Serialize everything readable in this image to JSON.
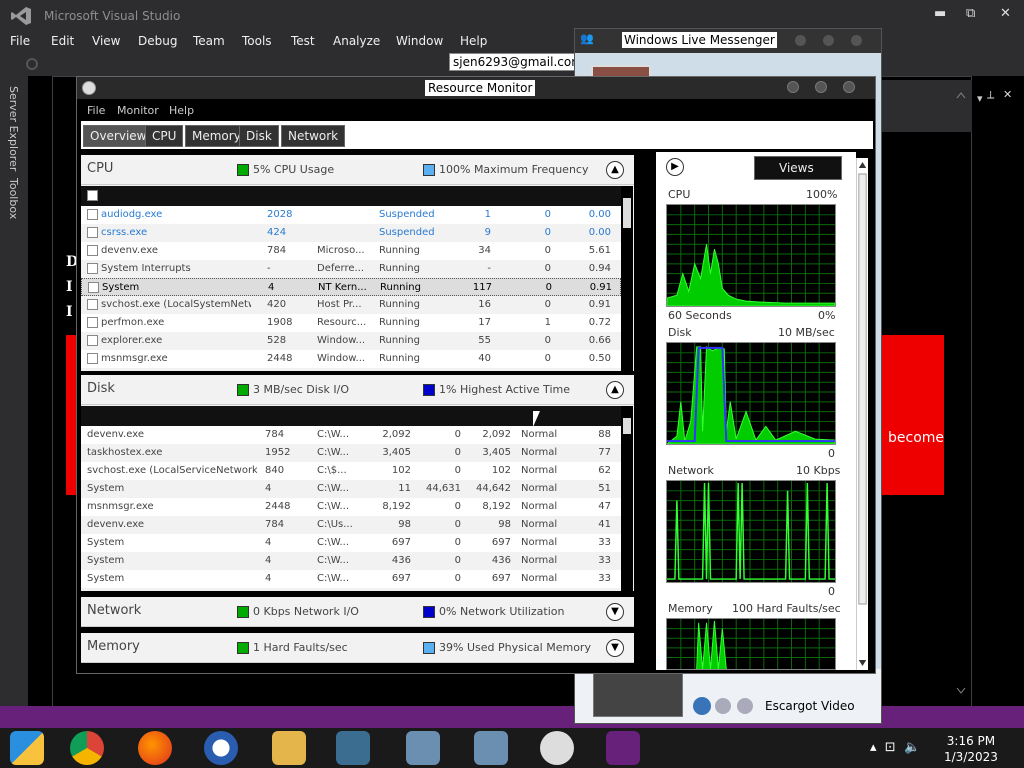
{
  "vs": {
    "title": "Microsoft Visual Studio",
    "window_controls": {
      "minimize": "✕",
      "maximize": "⧉",
      "close": "✕"
    },
    "menu": [
      "File",
      "Edit",
      "View",
      "Debug",
      "Team",
      "Tools",
      "Test",
      "Analyze",
      "Window",
      "Help"
    ],
    "account_email": "sjen6293@gmail.com",
    "side_tabs": [
      "Server Explorer",
      "Toolbox"
    ],
    "doc_letters": [
      "D",
      "I",
      "I"
    ],
    "red_box_text": "become",
    "accent": "#68217a"
  },
  "messenger": {
    "title": "Windows Live Messenger",
    "video_label": "Escargot Video"
  },
  "resmon": {
    "title": "Resource Monitor",
    "menu": [
      "File",
      "Monitor",
      "Help"
    ],
    "tabs": [
      "Overview",
      "CPU",
      "Memory",
      "Disk",
      "Network"
    ],
    "active_tab": "Overview",
    "cpu": {
      "title": "CPU",
      "stat1": "5% CPU Usage",
      "stat2": "100% Maximum Frequency",
      "rows": [
        {
          "name": "audiodg.exe",
          "pid": "2028",
          "desc": "",
          "status": "Suspended",
          "threads": "1",
          "cpu": "0",
          "avg": "0.00",
          "style": "blue"
        },
        {
          "name": "csrss.exe",
          "pid": "424",
          "desc": "",
          "status": "Suspended",
          "threads": "9",
          "cpu": "0",
          "avg": "0.00",
          "style": "blue"
        },
        {
          "name": "devenv.exe",
          "pid": "784",
          "desc": "Microso...",
          "status": "Running",
          "threads": "34",
          "cpu": "0",
          "avg": "5.61",
          "style": ""
        },
        {
          "name": "System Interrupts",
          "pid": "-",
          "desc": "Deferre...",
          "status": "Running",
          "threads": "-",
          "cpu": "0",
          "avg": "0.94",
          "style": ""
        },
        {
          "name": "System",
          "pid": "4",
          "desc": "NT Kern...",
          "status": "Running",
          "threads": "117",
          "cpu": "0",
          "avg": "0.91",
          "style": "sel"
        },
        {
          "name": "svchost.exe (LocalSystemNetw...",
          "pid": "420",
          "desc": "Host Pr...",
          "status": "Running",
          "threads": "16",
          "cpu": "0",
          "avg": "0.91",
          "style": ""
        },
        {
          "name": "perfmon.exe",
          "pid": "1908",
          "desc": "Resourc...",
          "status": "Running",
          "threads": "17",
          "cpu": "1",
          "avg": "0.72",
          "style": ""
        },
        {
          "name": "explorer.exe",
          "pid": "528",
          "desc": "Window...",
          "status": "Running",
          "threads": "55",
          "cpu": "0",
          "avg": "0.66",
          "style": ""
        },
        {
          "name": "msnmsgr.exe",
          "pid": "2448",
          "desc": "Window...",
          "status": "Running",
          "threads": "40",
          "cpu": "0",
          "avg": "0.50",
          "style": ""
        }
      ]
    },
    "disk": {
      "title": "Disk",
      "stat1": "3 MB/sec Disk I/O",
      "stat2": "1% Highest Active Time",
      "rows": [
        {
          "name": "devenv.exe",
          "pid": "784",
          "file": "C:\\W...",
          "read": "2,092",
          "write": "0",
          "total": "2,092",
          "prio": "Normal",
          "resp": "88"
        },
        {
          "name": "taskhostex.exe",
          "pid": "1952",
          "file": "C:\\W...",
          "read": "3,405",
          "write": "0",
          "total": "3,405",
          "prio": "Normal",
          "resp": "77"
        },
        {
          "name": "svchost.exe (LocalServiceNetwork...",
          "pid": "840",
          "file": "C:\\$...",
          "read": "102",
          "write": "0",
          "total": "102",
          "prio": "Normal",
          "resp": "62"
        },
        {
          "name": "System",
          "pid": "4",
          "file": "C:\\W...",
          "read": "11",
          "write": "44,631",
          "total": "44,642",
          "prio": "Normal",
          "resp": "51"
        },
        {
          "name": "msnmsgr.exe",
          "pid": "2448",
          "file": "C:\\W...",
          "read": "8,192",
          "write": "0",
          "total": "8,192",
          "prio": "Normal",
          "resp": "47"
        },
        {
          "name": "devenv.exe",
          "pid": "784",
          "file": "C:\\Us...",
          "read": "98",
          "write": "0",
          "total": "98",
          "prio": "Normal",
          "resp": "41"
        },
        {
          "name": "System",
          "pid": "4",
          "file": "C:\\W...",
          "read": "697",
          "write": "0",
          "total": "697",
          "prio": "Normal",
          "resp": "33"
        },
        {
          "name": "System",
          "pid": "4",
          "file": "C:\\W...",
          "read": "436",
          "write": "0",
          "total": "436",
          "prio": "Normal",
          "resp": "33"
        },
        {
          "name": "System",
          "pid": "4",
          "file": "C:\\W...",
          "read": "697",
          "write": "0",
          "total": "697",
          "prio": "Normal",
          "resp": "33"
        }
      ]
    },
    "network": {
      "title": "Network",
      "stat1": "0 Kbps Network I/O",
      "stat2": "0% Network Utilization"
    },
    "memory": {
      "title": "Memory",
      "stat1": "1 Hard Faults/sec",
      "stat2": "39% Used Physical Memory"
    },
    "graphs": {
      "views_label": "Views",
      "cpu": {
        "label": "CPU",
        "max": "100%",
        "time": "60 Seconds",
        "min": "0%"
      },
      "disk": {
        "label": "Disk",
        "max": "10 MB/sec",
        "min": "0"
      },
      "network": {
        "label": "Network",
        "max": "10 Kbps",
        "min": "0"
      },
      "memory": {
        "label": "Memory",
        "max": "100 Hard Faults/sec"
      }
    }
  },
  "taskbar": {
    "time": "3:16 PM",
    "date": "1/3/2023",
    "icons": [
      "chrome-icon",
      "firefox-icon",
      "opera-icon",
      "explorer-icon",
      "messenger-icon",
      "setup-icon",
      "setup2-icon",
      "resmon-icon",
      "visual-studio-icon"
    ]
  }
}
